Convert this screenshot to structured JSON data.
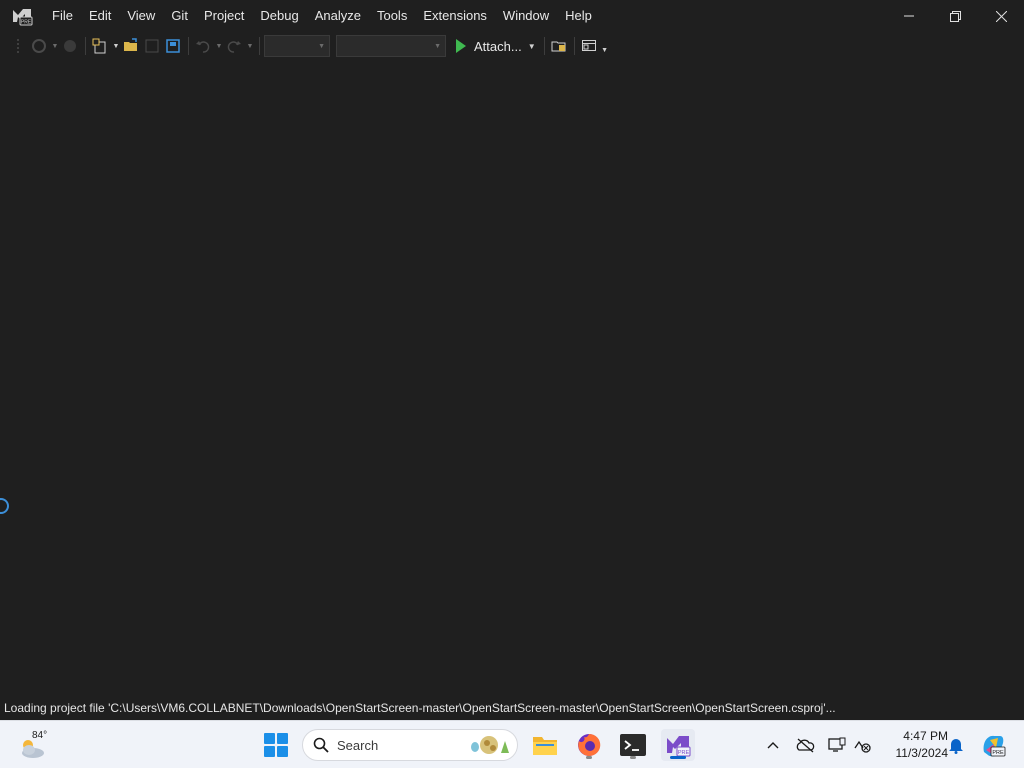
{
  "titlebar": {
    "app_icon": "visual-studio-preview-icon",
    "menu": [
      "File",
      "Edit",
      "View",
      "Git",
      "Project",
      "Debug",
      "Analyze",
      "Tools",
      "Extensions",
      "Window",
      "Help"
    ],
    "controls": [
      "minimize-icon",
      "restore-icon",
      "close-icon"
    ]
  },
  "toolbar": {
    "attach_label": "Attach...",
    "play_color": "#3fb950"
  },
  "main": {
    "spinner_icon": "loading-spinner-icon"
  },
  "statusbar": {
    "text": "Loading project file 'C:\\Users\\VM6.COLLABNET\\Downloads\\OpenStartScreen-master\\OpenStartScreen-master\\OpenStartScreen\\OpenStartScreen.csproj'..."
  },
  "taskbar": {
    "weather_temp": "84°",
    "search_label": "Search",
    "apps": [
      "file-explorer-icon",
      "firefox-icon",
      "terminal-icon",
      "visual-studio-preview-icon"
    ],
    "tray": [
      "chevron-up-icon",
      "onedrive-icon",
      "display-icon",
      "network-icon",
      "notification-icon",
      "copilot-icon"
    ],
    "time": "4:47 PM",
    "date": "11/3/2024",
    "accent": "#0a64c9"
  }
}
